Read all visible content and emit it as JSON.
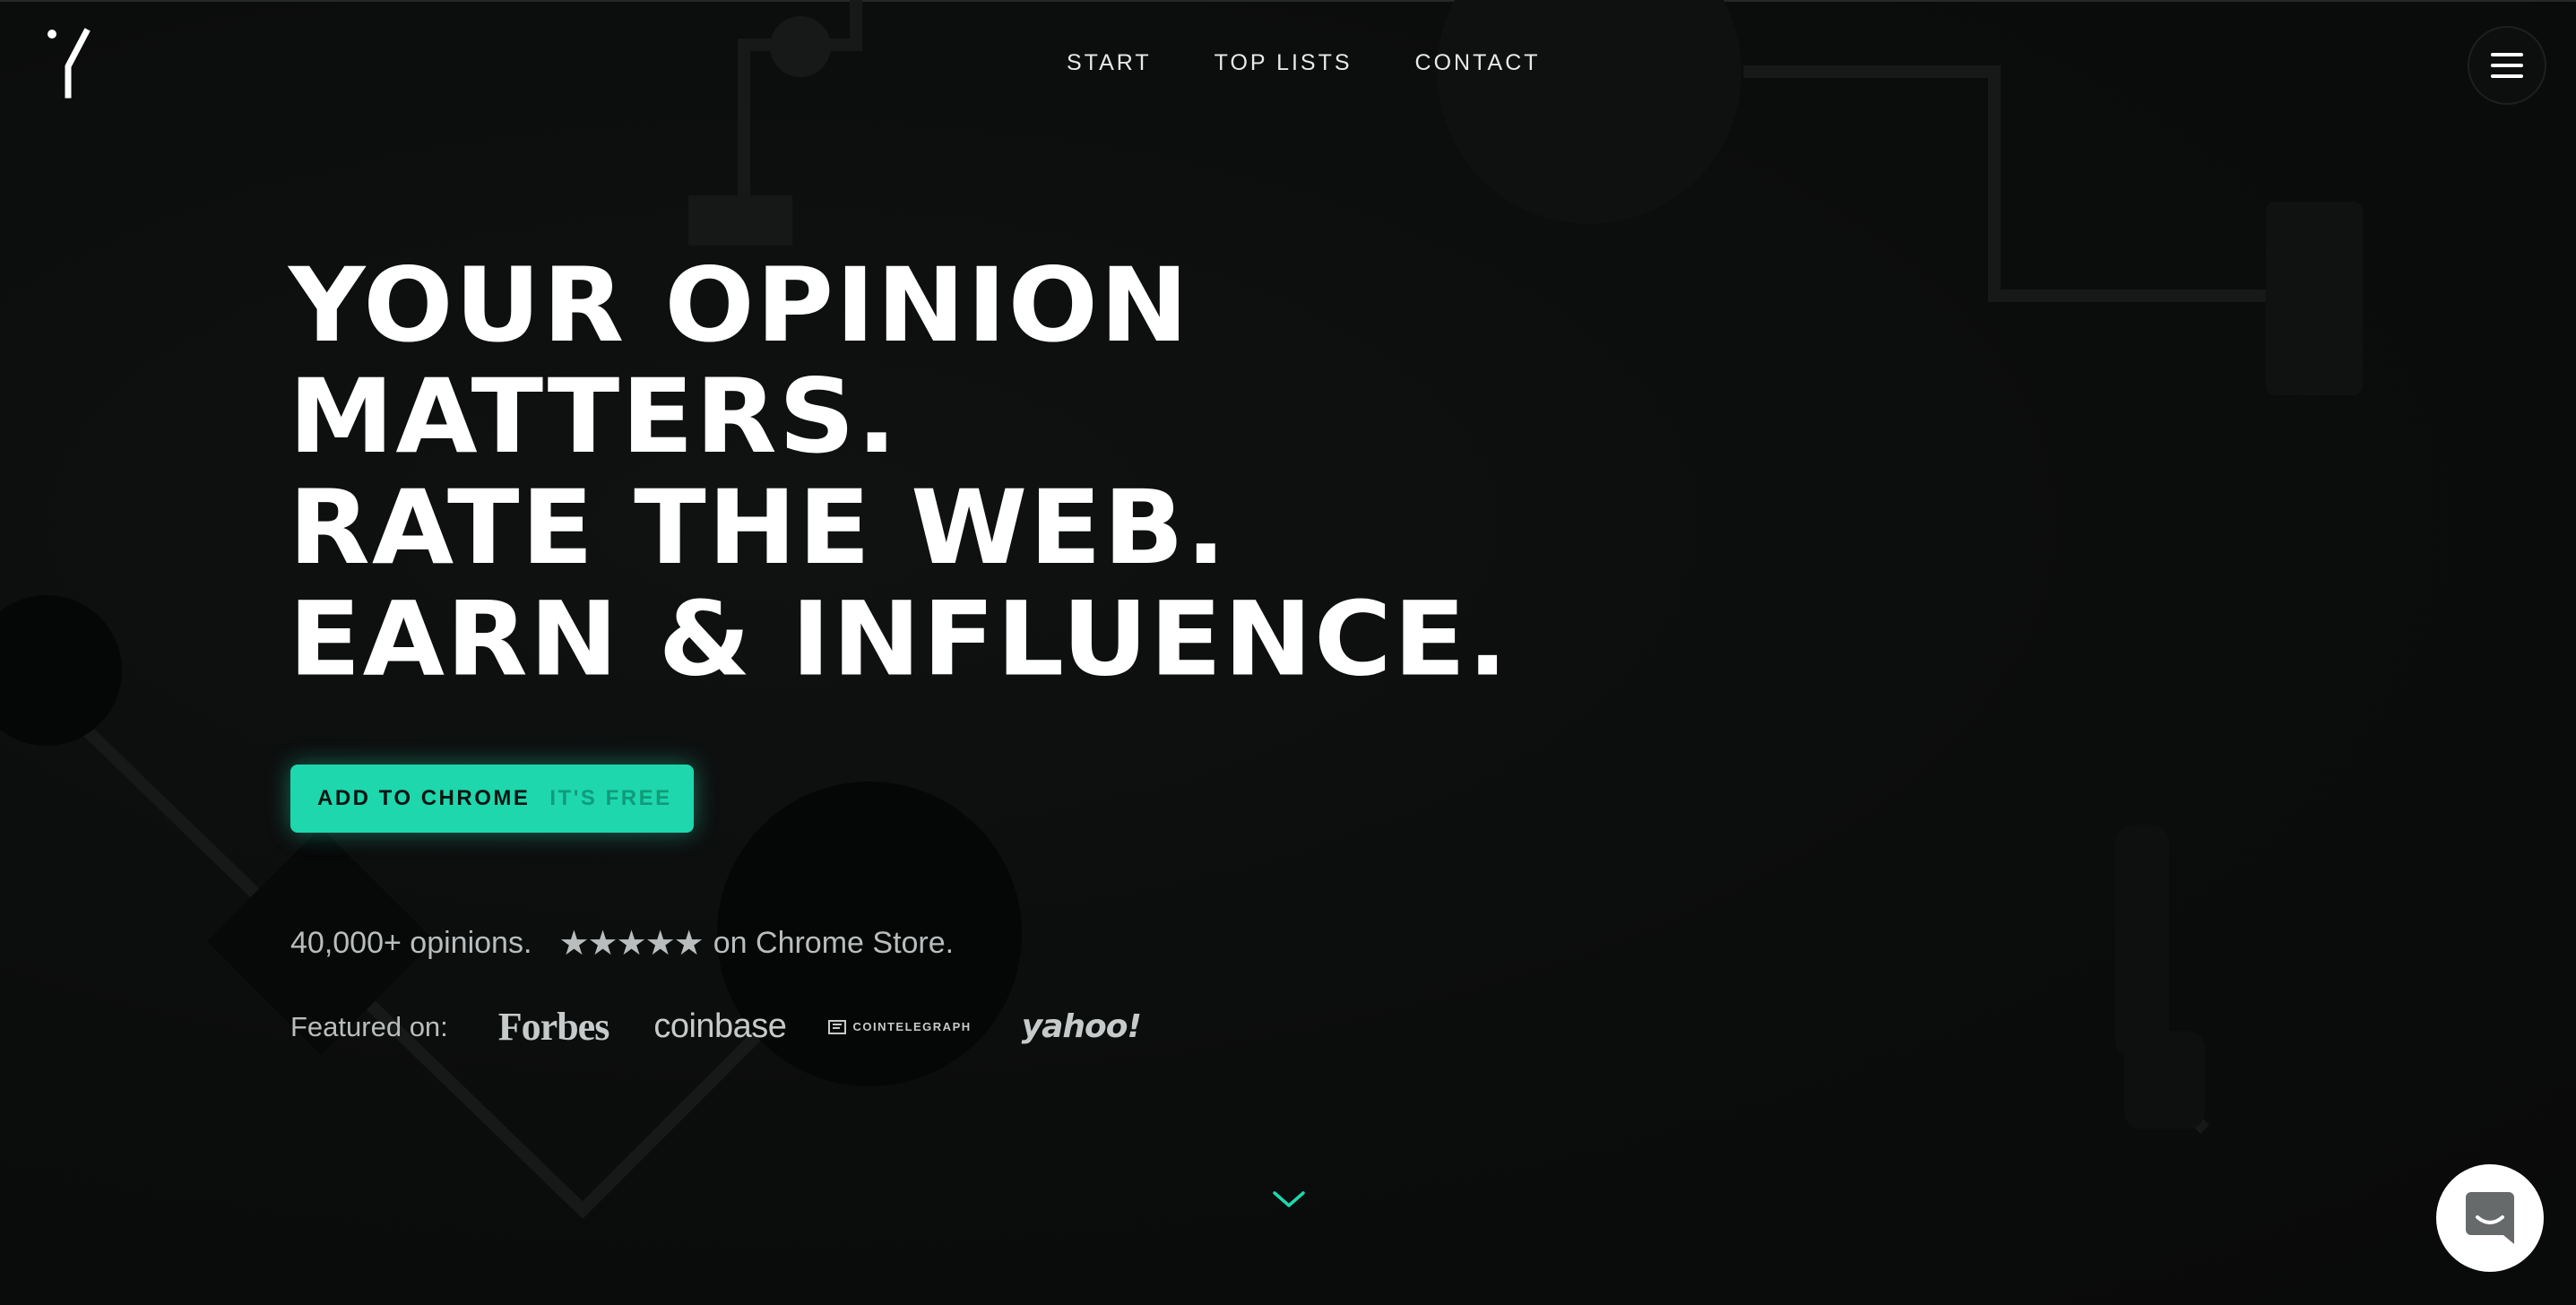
{
  "nav": {
    "items": [
      {
        "label": "START"
      },
      {
        "label": "TOP LISTS"
      },
      {
        "label": "CONTACT"
      }
    ],
    "menu_icon": "hamburger-icon",
    "logo_icon": "brand-logo-icon"
  },
  "hero": {
    "headline_lines": [
      "YOUR OPINION",
      "MATTERS.",
      "RATE THE WEB.",
      "EARN & INFLUENCE."
    ],
    "cta": {
      "label": "ADD TO CHROME",
      "sublabel": "IT'S FREE"
    },
    "stats": {
      "opinions": "40,000+ opinions.",
      "stars": "★★★★★",
      "rating_text": "on Chrome Store."
    },
    "featured": {
      "label": "Featured on:",
      "logos": [
        {
          "name": "Forbes"
        },
        {
          "name": "coinbase"
        },
        {
          "name": "COINTELEGRAPH"
        },
        {
          "name": "yahoo!"
        }
      ]
    }
  },
  "icons": {
    "scroll": "chevron-down-icon",
    "chat": "chat-icon"
  },
  "colors": {
    "background": "#0b0c0c",
    "accent": "#1ed7ad",
    "accent_dark_text": "#0f9b7b",
    "text_primary": "#ffffff",
    "text_muted": "#b9bdbd"
  }
}
